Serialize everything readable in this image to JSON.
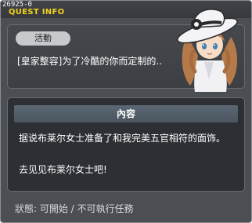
{
  "window": {
    "id": "26925-0",
    "title": "QUEST INFO"
  },
  "activity": {
    "tag": "活動",
    "title": "[皇家整容]为了冷酷的你而定制的.."
  },
  "content": {
    "header": "內容",
    "lines": [
      "据说布莱尔女士准备了和我完美五官相符的面饰。",
      "去见见布莱尔女士吧!"
    ]
  },
  "status": {
    "text": "狀態: 可開始 / 不可執行任務"
  },
  "portrait": {
    "icon": "npc-portrait-icon"
  },
  "colors": {
    "title": "#f2d31a",
    "window_bg": "#4b4e53",
    "content_bg": "#2c2f33",
    "header_bg": "#5b6772"
  }
}
